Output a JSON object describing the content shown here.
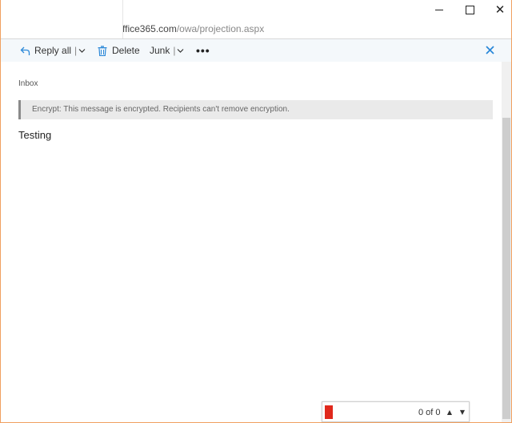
{
  "browser": {
    "address": {
      "visible_url_main": "ffice365.com",
      "visible_url_path": "/owa/projection.aspx"
    },
    "window_controls": {
      "minimize_icon": "minimize-icon",
      "maximize_icon": "maximize-icon",
      "close_glyph": "✕"
    }
  },
  "toolbar": {
    "reply_all_label": "Reply all",
    "delete_label": "Delete",
    "junk_label": "Junk",
    "more_label": "•••",
    "close_glyph": "✕",
    "accent_color": "#2b88d8"
  },
  "message": {
    "folder": "Inbox",
    "encryption_notice": "Encrypt: This message is encrypted. Recipients can't remove encryption.",
    "body": "Testing"
  },
  "findbar": {
    "count": "0 of 0",
    "up_glyph": "▲",
    "down_glyph": "▼",
    "input_color": "#e0281c"
  }
}
